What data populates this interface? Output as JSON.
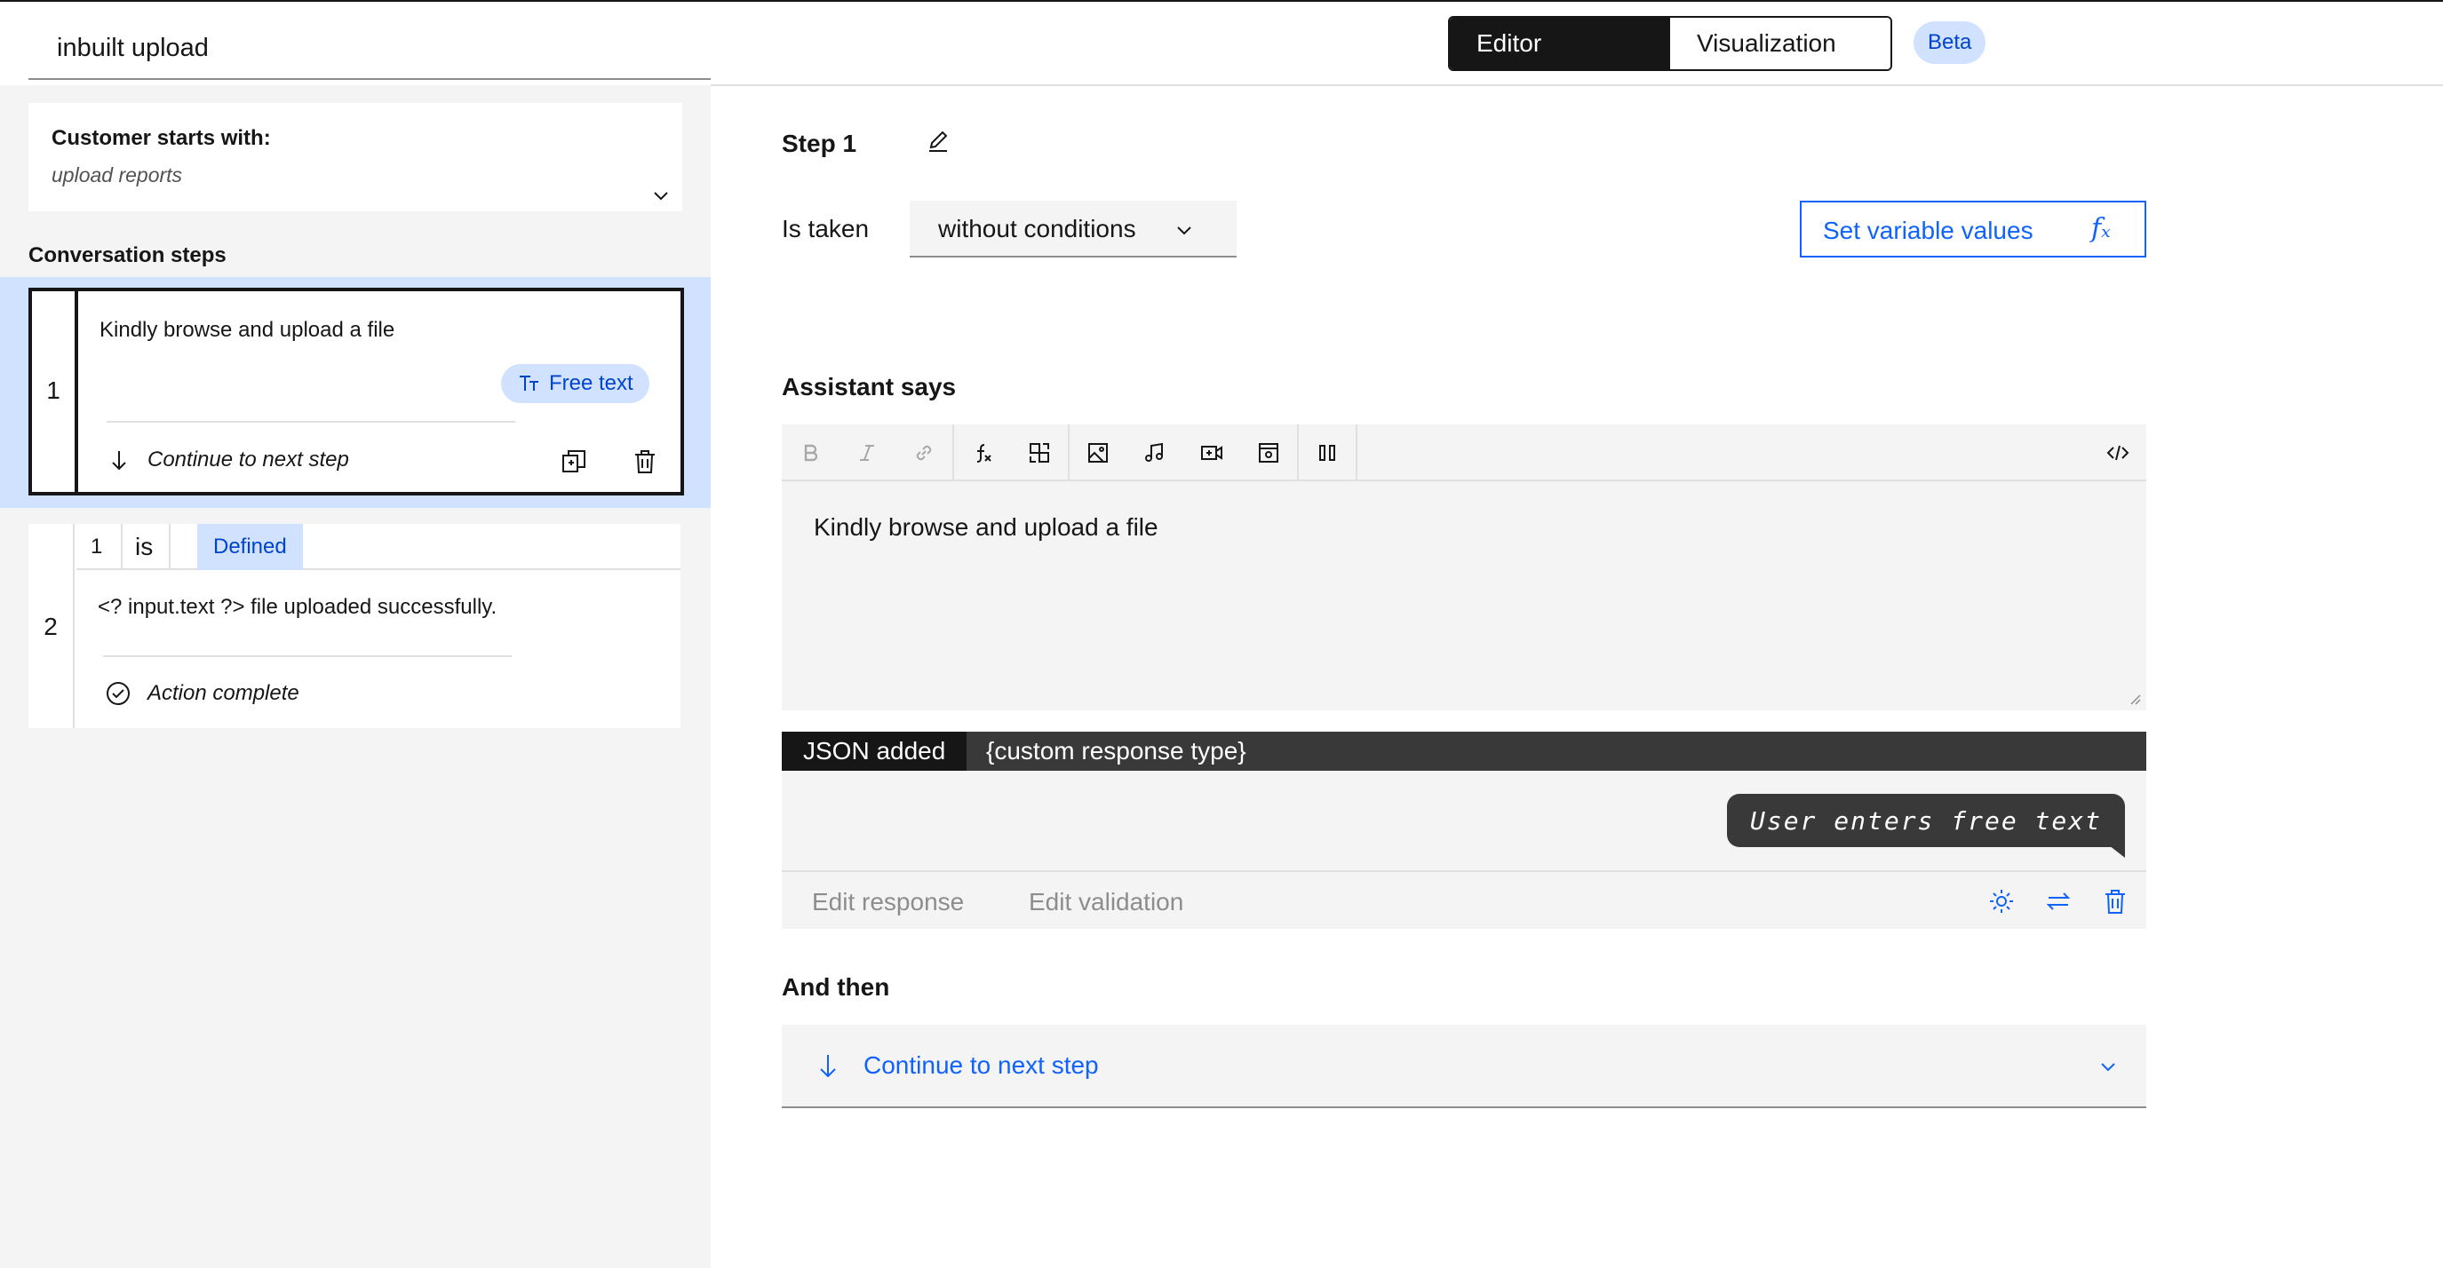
{
  "action": {
    "title": "inbuilt upload"
  },
  "customer_starts": {
    "label": "Customer starts with:",
    "phrase": "upload reports"
  },
  "sidebar": {
    "heading": "Conversation steps",
    "steps": [
      {
        "number": "1",
        "text": "Kindly browse and upload a file",
        "response_type": "Free text",
        "next": "Continue to next step"
      },
      {
        "number": "2",
        "condition": {
          "ref": "1",
          "operator": "is",
          "value": "Defined"
        },
        "text": "<? input.text ?> file uploaded successfully.",
        "next": "Action complete"
      }
    ]
  },
  "view_switcher": {
    "options": [
      "Editor",
      "Visualization"
    ],
    "selected": "Editor",
    "badge": "Beta"
  },
  "editor": {
    "step_title": "Step 1",
    "is_taken_label": "Is taken",
    "is_taken_value": "without conditions",
    "set_variable_button": "Set variable values",
    "set_variable_icon": "𝑓ₓ",
    "assistant_says_heading": "Assistant says",
    "message": "Kindly browse and upload a file",
    "toolbar": [
      "bold",
      "italic",
      "link",
      "function",
      "variable",
      "image",
      "audio",
      "video",
      "iframe",
      "columns",
      "code"
    ],
    "json_tag": "JSON added",
    "json_type": "{custom response type}",
    "user_bubble": "User enters free text",
    "edit_response": "Edit response",
    "edit_validation": "Edit validation",
    "and_then_heading": "And then",
    "and_then_value": "Continue to next step"
  },
  "colors": {
    "accent": "#0f62fe",
    "tag_bg": "#d0e2ff",
    "tag_text": "#0043ce",
    "dark": "#161616",
    "panel": "#f4f4f4"
  }
}
